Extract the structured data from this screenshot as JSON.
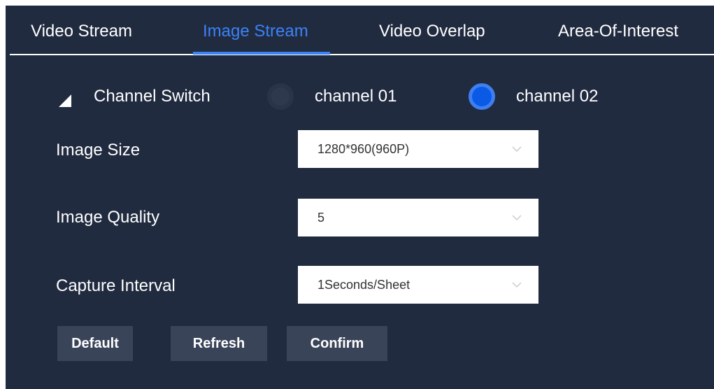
{
  "tabs": [
    {
      "label": "Video Stream",
      "active": false
    },
    {
      "label": "Image Stream",
      "active": true
    },
    {
      "label": "Video Overlap",
      "active": false
    },
    {
      "label": "Area-Of-Interest",
      "active": false
    }
  ],
  "channel_switch": {
    "label": "Channel Switch",
    "icon": "collapse-triangle-icon",
    "options": [
      {
        "label": "channel 01",
        "selected": false
      },
      {
        "label": "channel 02",
        "selected": true
      }
    ]
  },
  "fields": {
    "image_size": {
      "label": "Image Size",
      "value": "1280*960(960P)"
    },
    "image_quality": {
      "label": "Image Quality",
      "value": "5"
    },
    "capture_interval": {
      "label": "Capture Interval",
      "value": "1Seconds/Sheet"
    }
  },
  "buttons": {
    "default": "Default",
    "refresh": "Refresh",
    "confirm": "Confirm"
  },
  "colors": {
    "panel_background": "#212b40",
    "accent": "#3b82f6",
    "button_background": "#3a4458"
  }
}
